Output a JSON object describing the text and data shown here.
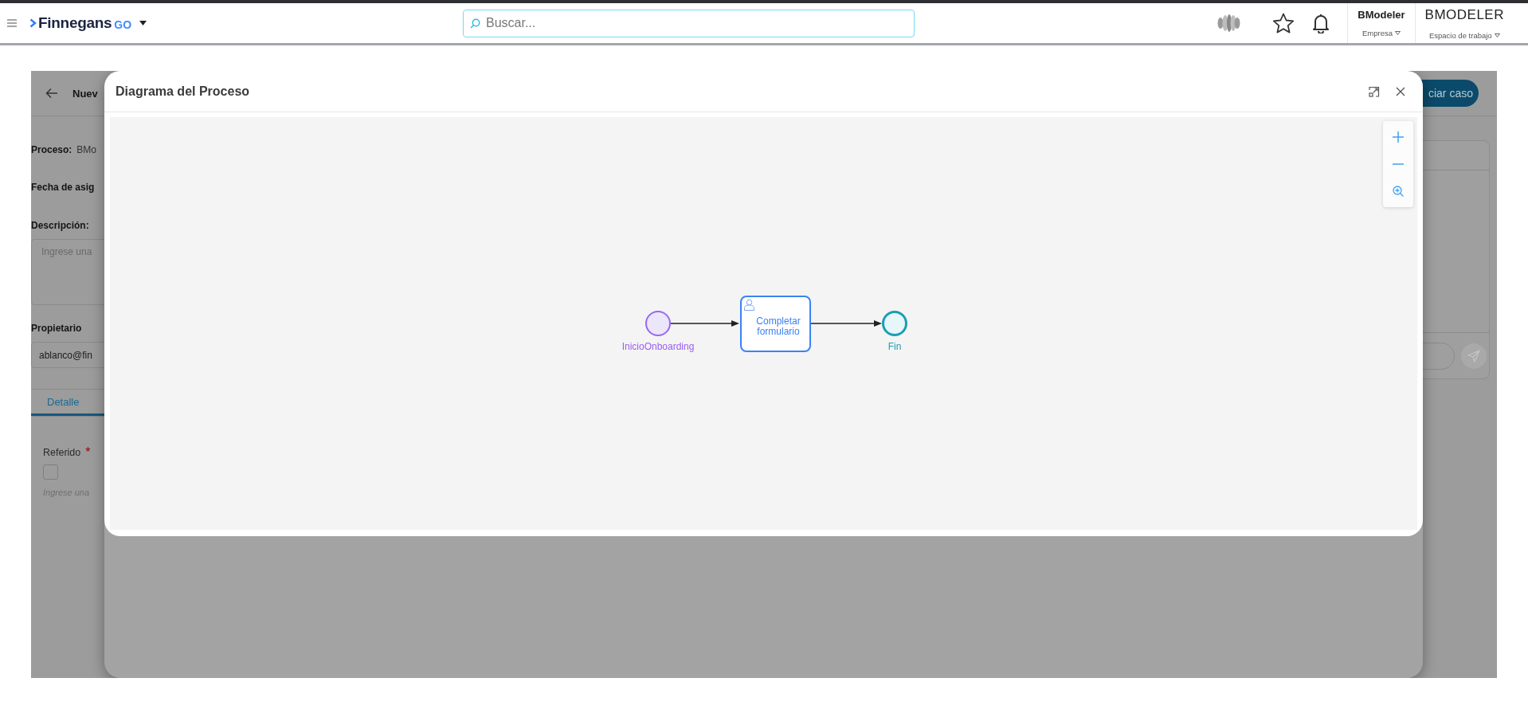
{
  "header": {
    "logo": {
      "name": "Finnegans",
      "suffix": "GO"
    },
    "search": {
      "placeholder": "Buscar..."
    },
    "company": {
      "name": "BModeler",
      "label": "Empresa"
    },
    "workspace": {
      "name": "BMODELER",
      "label": "Espacio de trabajo"
    }
  },
  "page": {
    "title": "Nuev",
    "action": "ciar caso",
    "fields": [
      {
        "kind": "inline",
        "label": "Proceso:",
        "value": "BMo"
      },
      {
        "kind": "inline",
        "label": "Fecha de asig"
      },
      {
        "kind": "textarea",
        "label": "Descripción:",
        "placeholder": "Ingrese una"
      },
      {
        "kind": "input",
        "label": "Propietario",
        "value": "ablanco@fin"
      }
    ],
    "tabs": [
      {
        "label": "Detalle",
        "selected": true
      }
    ],
    "form": [
      {
        "label": "Referido",
        "marker": "*",
        "checked": false,
        "hint": "Ingrese una"
      }
    ]
  },
  "modal": {
    "title": "Diagrama del Proceso",
    "diagram": {
      "nodes": [
        {
          "kind": "start",
          "label": "InicioOnboarding"
        },
        {
          "kind": "task",
          "label": "Completar formulario"
        },
        {
          "kind": "end",
          "label": "Fin"
        }
      ]
    }
  }
}
